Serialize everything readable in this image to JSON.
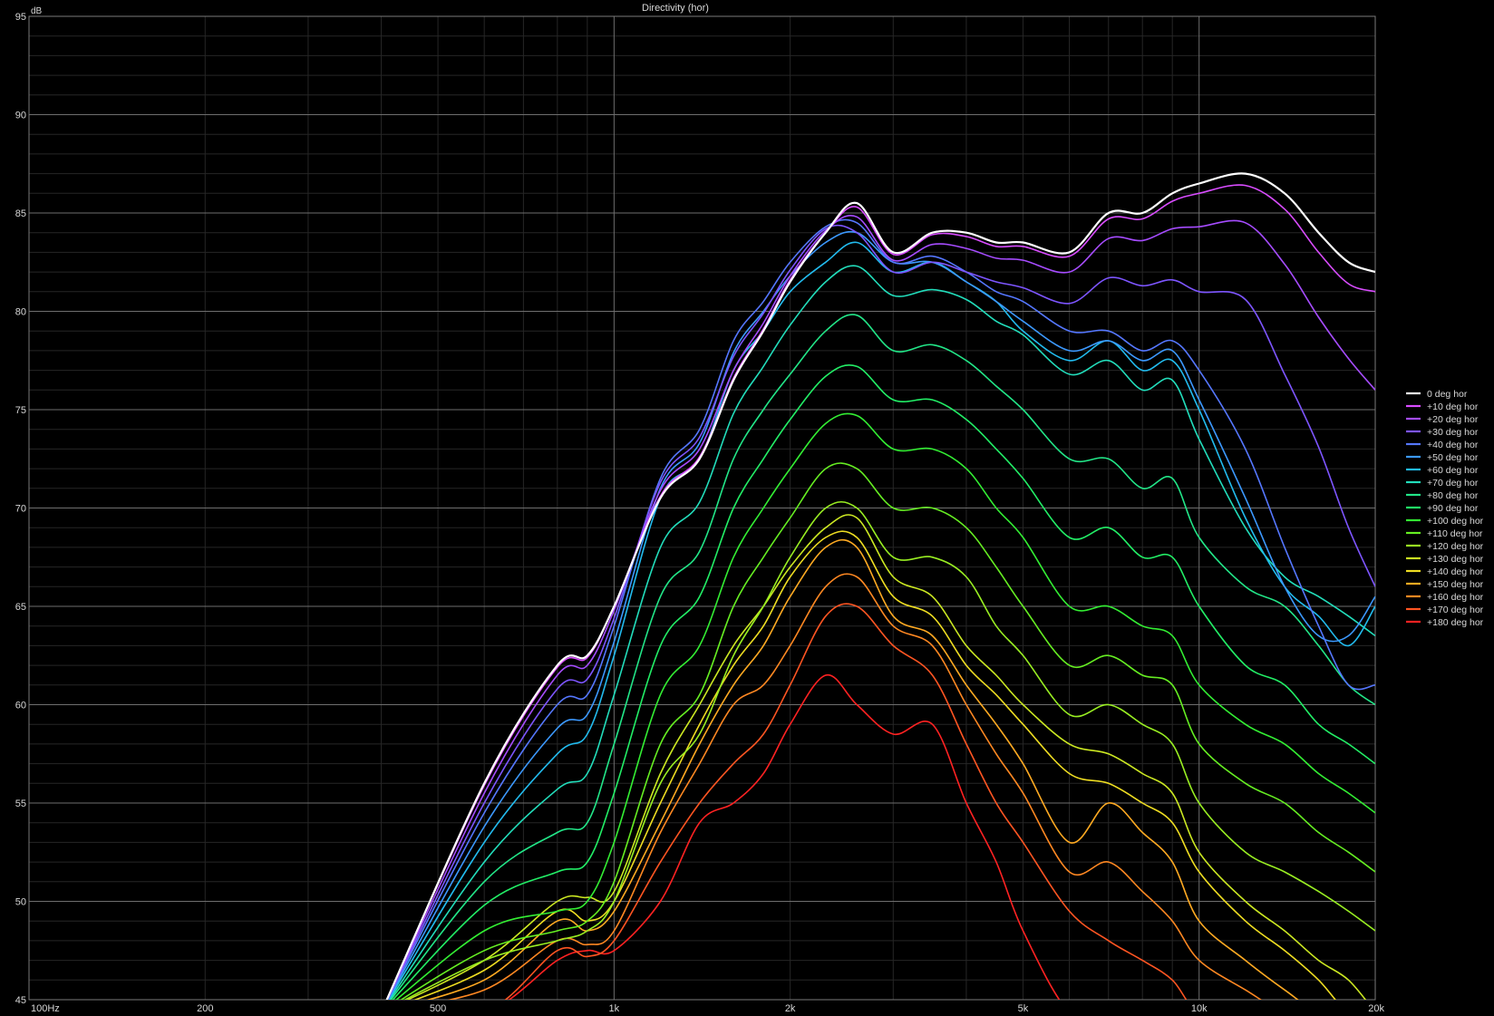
{
  "chart_data": {
    "type": "line",
    "title": "Directivity (hor)",
    "ylabel": "dB",
    "xlabel": "",
    "x_scale": "log",
    "xlim": [
      100,
      20000
    ],
    "ylim": [
      45,
      95
    ],
    "x_tick_labels": [
      {
        "value": 100,
        "label": "100Hz"
      },
      {
        "value": 200,
        "label": "200"
      },
      {
        "value": 500,
        "label": "500"
      },
      {
        "value": 1000,
        "label": "1k"
      },
      {
        "value": 2000,
        "label": "2k"
      },
      {
        "value": 5000,
        "label": "5k"
      },
      {
        "value": 10000,
        "label": "10k"
      },
      {
        "value": 20000,
        "label": "20k"
      }
    ],
    "y_tick_labels": [
      {
        "value": 95,
        "label": "95"
      },
      {
        "value": 90,
        "label": "90"
      },
      {
        "value": 85,
        "label": "85"
      },
      {
        "value": 80,
        "label": "80"
      },
      {
        "value": 75,
        "label": "75"
      },
      {
        "value": 70,
        "label": "70"
      },
      {
        "value": 65,
        "label": "65"
      },
      {
        "value": 60,
        "label": "60"
      },
      {
        "value": 55,
        "label": "55"
      },
      {
        "value": 50,
        "label": "50"
      },
      {
        "value": 45,
        "label": "45"
      }
    ],
    "grid": true,
    "legend_position": "right",
    "background": "#000000",
    "x": [
      400,
      600,
      800,
      900,
      1000,
      1200,
      1400,
      1600,
      1800,
      2000,
      2300,
      2600,
      3000,
      3500,
      4000,
      4500,
      5000,
      6000,
      7000,
      8000,
      9000,
      10000,
      12000,
      14000,
      16000,
      18000,
      20000
    ],
    "series": [
      {
        "name": "0 deg hor",
        "color": "#ffffff",
        "values": [
          45.0,
          56.0,
          62.0,
          62.5,
          65.0,
          70.5,
          72.5,
          76.5,
          79.0,
          81.5,
          84.0,
          85.5,
          83.0,
          84.0,
          84.0,
          83.5,
          83.5,
          83.0,
          85.0,
          85.0,
          86.0,
          86.5,
          87.0,
          86.0,
          84.0,
          82.5,
          82.0
        ]
      },
      {
        "name": "+10 deg hor",
        "color": "#d94cff",
        "values": [
          45.0,
          55.9,
          61.9,
          62.4,
          65.0,
          70.6,
          72.6,
          76.6,
          79.1,
          81.6,
          84.0,
          85.3,
          82.9,
          83.9,
          83.8,
          83.3,
          83.3,
          82.8,
          84.7,
          84.7,
          85.6,
          86.0,
          86.4,
          85.2,
          83.0,
          81.4,
          81.0
        ]
      },
      {
        "name": "+20 deg hor",
        "color": "#a64cff",
        "values": [
          45.0,
          55.5,
          61.5,
          62.0,
          64.8,
          70.9,
          73.0,
          77.0,
          79.4,
          81.8,
          84.1,
          84.8,
          82.6,
          83.4,
          83.2,
          82.7,
          82.6,
          82.0,
          83.7,
          83.6,
          84.2,
          84.3,
          84.5,
          82.4,
          79.7,
          77.6,
          76.0
        ]
      },
      {
        "name": "+30 deg hor",
        "color": "#7d55ff",
        "values": [
          45.0,
          55.0,
          60.8,
          61.3,
          64.4,
          71.3,
          73.6,
          77.7,
          79.9,
          82.1,
          84.2,
          84.0,
          82.0,
          82.5,
          82.0,
          81.5,
          81.2,
          80.4,
          81.7,
          81.3,
          81.6,
          81.0,
          80.6,
          76.8,
          73.1,
          69.0,
          66.0
        ]
      },
      {
        "name": "+40 deg hor",
        "color": "#5577ff",
        "values": [
          45.0,
          54.5,
          60.0,
          60.5,
          64.0,
          71.5,
          74.0,
          78.5,
          80.5,
          82.5,
          84.3,
          84.5,
          82.5,
          82.8,
          82.0,
          81.0,
          80.5,
          79.0,
          79.0,
          78.0,
          78.5,
          77.0,
          73.0,
          68.0,
          64.0,
          61.0,
          61.0
        ]
      },
      {
        "name": "+50 deg hor",
        "color": "#3c99ff",
        "values": [
          45.0,
          53.8,
          58.8,
          59.5,
          63.2,
          71.0,
          73.3,
          77.9,
          80.0,
          81.8,
          83.5,
          84.0,
          82.5,
          82.5,
          81.5,
          80.5,
          79.5,
          78.0,
          78.5,
          77.5,
          78.0,
          75.5,
          70.5,
          66.0,
          63.5,
          63.5,
          65.5
        ]
      },
      {
        "name": "+60 deg hor",
        "color": "#22bbee",
        "values": [
          45.0,
          53.0,
          57.5,
          58.5,
          62.5,
          70.5,
          72.5,
          77.0,
          79.0,
          81.0,
          82.5,
          83.5,
          82.0,
          82.5,
          81.5,
          80.5,
          79.0,
          77.5,
          78.5,
          77.0,
          77.5,
          75.0,
          69.5,
          66.0,
          64.5,
          63.0,
          65.0
        ]
      },
      {
        "name": "+70 deg hor",
        "color": "#22ddbb",
        "values": [
          45.0,
          52.0,
          55.7,
          56.5,
          60.5,
          68.0,
          70.3,
          74.8,
          77.2,
          79.3,
          81.5,
          82.3,
          80.8,
          81.1,
          80.6,
          79.5,
          78.8,
          76.8,
          77.5,
          76.0,
          76.5,
          73.5,
          69.0,
          66.5,
          65.5,
          64.5,
          63.5
        ]
      },
      {
        "name": "+80 deg hor",
        "color": "#22e688",
        "values": [
          45.0,
          51.0,
          53.5,
          54.0,
          58.0,
          65.5,
          67.8,
          72.5,
          75.0,
          76.8,
          79.0,
          79.8,
          78.0,
          78.3,
          77.5,
          76.2,
          75.0,
          72.5,
          72.5,
          71.0,
          71.5,
          68.5,
          66.0,
          65.0,
          63.0,
          61.0,
          60.0
        ]
      },
      {
        "name": "+90 deg hor",
        "color": "#22ee66",
        "values": [
          45.0,
          49.8,
          51.5,
          52.0,
          55.5,
          63.0,
          65.5,
          70.0,
          72.5,
          74.5,
          76.7,
          77.2,
          75.5,
          75.5,
          74.5,
          73.0,
          71.5,
          68.5,
          69.0,
          67.5,
          67.5,
          65.0,
          62.0,
          61.0,
          59.0,
          58.0,
          57.0
        ]
      },
      {
        "name": "+100 deg hor",
        "color": "#33ee33",
        "values": [
          45.0,
          48.5,
          49.5,
          50.0,
          53.0,
          60.5,
          63.0,
          67.5,
          70.0,
          72.0,
          74.3,
          74.7,
          73.0,
          73.0,
          72.0,
          70.0,
          68.5,
          65.0,
          65.0,
          64.0,
          63.5,
          61.0,
          59.0,
          58.0,
          56.5,
          55.5,
          54.5
        ]
      },
      {
        "name": "+110 deg hor",
        "color": "#66ee22",
        "values": [
          45.0,
          47.5,
          48.5,
          49.0,
          51.0,
          58.0,
          60.5,
          65.0,
          67.5,
          69.5,
          72.0,
          72.0,
          70.0,
          70.0,
          69.0,
          67.0,
          65.0,
          62.0,
          62.5,
          61.5,
          61.0,
          58.0,
          56.0,
          55.0,
          53.5,
          52.5,
          51.5
        ]
      },
      {
        "name": "+120 deg hor",
        "color": "#99ee22",
        "values": [
          45.0,
          47.0,
          48.0,
          48.5,
          50.0,
          56.0,
          58.5,
          62.5,
          65.0,
          67.5,
          70.0,
          70.0,
          67.5,
          67.5,
          66.5,
          64.0,
          62.5,
          59.5,
          60.0,
          59.0,
          58.0,
          55.0,
          52.5,
          51.5,
          50.5,
          49.5,
          48.5
        ]
      },
      {
        "name": "+130 deg hor",
        "color": "#cce822",
        "values": [
          45.0,
          47.0,
          50.0,
          50.2,
          50.5,
          56.5,
          60.0,
          63.0,
          65.0,
          67.0,
          69.0,
          69.5,
          66.5,
          65.5,
          63.0,
          61.5,
          60.0,
          58.0,
          57.5,
          56.5,
          55.5,
          52.5,
          50.0,
          48.5,
          47.0,
          46.0,
          45.0
        ]
      },
      {
        "name": "+140 deg hor",
        "color": "#eedd22",
        "values": [
          45.0,
          46.5,
          49.5,
          49.0,
          50.0,
          55.0,
          59.0,
          62.0,
          64.0,
          66.5,
          68.5,
          68.5,
          65.5,
          64.5,
          62.0,
          60.5,
          59.0,
          56.5,
          56.0,
          55.0,
          54.0,
          51.5,
          49.0,
          47.5,
          46.0,
          45.0,
          45.0
        ]
      },
      {
        "name": "+150 deg hor",
        "color": "#ffaa22",
        "values": [
          45.0,
          46.0,
          49.0,
          48.5,
          49.5,
          54.0,
          58.0,
          61.0,
          63.0,
          65.5,
          68.0,
          68.0,
          64.5,
          63.5,
          61.0,
          59.0,
          57.0,
          53.0,
          55.0,
          53.5,
          52.0,
          49.0,
          47.0,
          45.5,
          45.0,
          45.0,
          45.0
        ]
      },
      {
        "name": "+160 deg hor",
        "color": "#ff8822",
        "values": [
          45.0,
          45.5,
          48.0,
          47.8,
          48.5,
          53.5,
          57.0,
          60.0,
          61.0,
          63.0,
          66.0,
          66.5,
          64.0,
          63.0,
          60.0,
          57.5,
          55.5,
          51.5,
          52.0,
          50.5,
          49.0,
          47.0,
          45.5,
          45.0,
          45.0,
          45.0,
          45.0
        ]
      },
      {
        "name": "+170 deg hor",
        "color": "#ff5522",
        "values": [
          45.0,
          45.0,
          47.5,
          47.2,
          48.0,
          52.0,
          55.0,
          57.0,
          58.5,
          61.0,
          64.5,
          65.0,
          63.0,
          61.5,
          58.0,
          55.0,
          53.0,
          49.5,
          48.0,
          47.0,
          46.0,
          45.0,
          45.0,
          45.0,
          45.0,
          45.0,
          45.0
        ]
      },
      {
        "name": "+180 deg hor",
        "color": "#ff2222",
        "values": [
          45.0,
          45.0,
          47.0,
          47.5,
          47.5,
          50.0,
          54.0,
          55.0,
          56.5,
          59.0,
          61.5,
          60.0,
          58.5,
          59.0,
          55.0,
          52.0,
          48.5,
          45.0,
          45.0,
          45.0,
          45.0,
          45.0,
          45.0,
          45.0,
          45.0,
          45.0,
          45.0
        ]
      }
    ]
  }
}
